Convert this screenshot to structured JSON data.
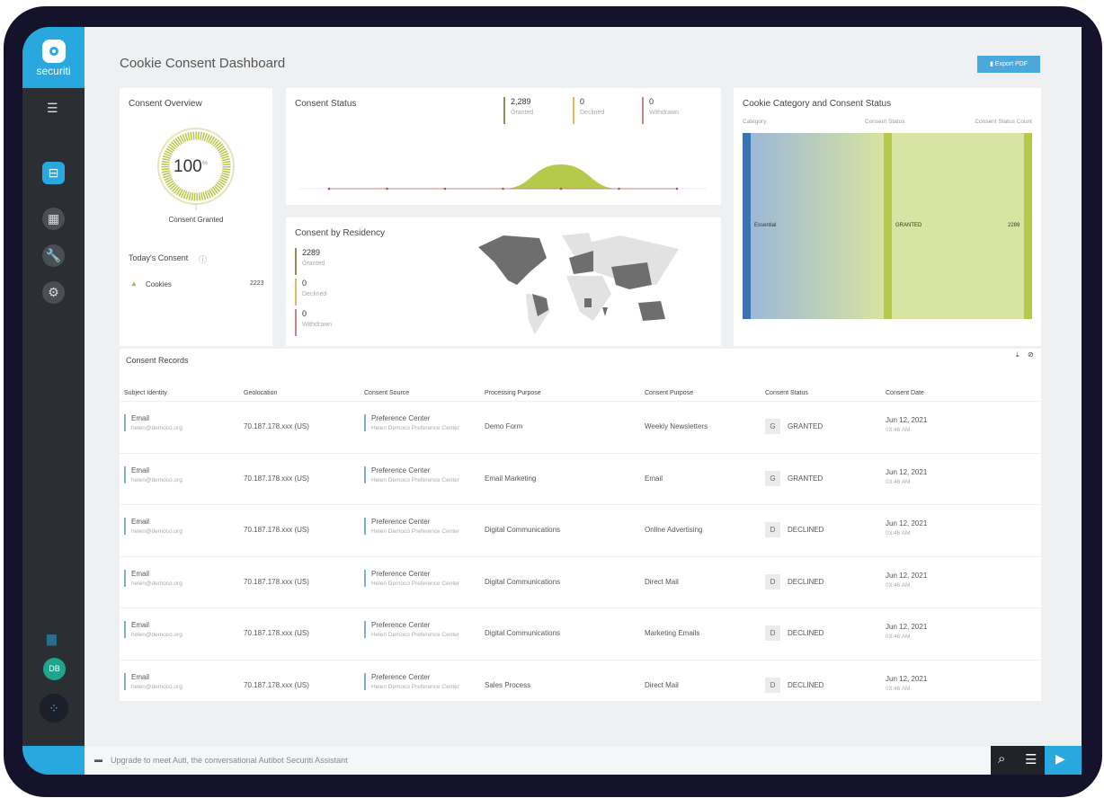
{
  "app": {
    "brand": "securiti",
    "page_title": "Cookie Consent Dashboard",
    "export_label": "Export PDF",
    "user_initials": "DB"
  },
  "colors": {
    "brand": "#29a8e0",
    "granted": "#b5c94a",
    "declined": "#e1b86a",
    "withdrawn": "#c98585",
    "essential": "#3a73b0"
  },
  "overview": {
    "title": "Consent Overview",
    "percent": "100",
    "percent_unit": "%",
    "gauge_label": "Consent Granted",
    "gauge_fraction": 1.0,
    "today_title": "Today's Consent",
    "items": [
      {
        "label": "Cookies",
        "value": "2223"
      }
    ]
  },
  "status": {
    "title": "Consent Status",
    "stats": [
      {
        "value": "2,289",
        "label": "Granted"
      },
      {
        "value": "0",
        "label": "Declined"
      },
      {
        "value": "0",
        "label": "Withdrawn"
      }
    ]
  },
  "residency": {
    "title": "Consent by Residency",
    "stats": [
      {
        "value": "2289",
        "label": "Granted"
      },
      {
        "value": "0",
        "label": "Declined"
      },
      {
        "value": "0",
        "label": "Withdrawn"
      }
    ]
  },
  "chart_data": [
    {
      "type": "area",
      "title": "Consent Status",
      "x": [
        1,
        2,
        3,
        4,
        5,
        6,
        7
      ],
      "series": [
        {
          "name": "Granted",
          "values": [
            0,
            0,
            0,
            0,
            2289,
            0,
            0
          ]
        },
        {
          "name": "Withdrawn",
          "values": [
            0,
            0,
            0,
            0,
            0,
            0,
            0
          ]
        }
      ],
      "grid": false
    },
    {
      "type": "sankey",
      "title": "Cookie Category and Consent Status",
      "columns": [
        "Category",
        "Consent Status",
        "Consent Status Count"
      ],
      "flows": [
        {
          "source": "Essential",
          "target": "GRANTED",
          "value": 2289
        }
      ],
      "count_label": "2289"
    }
  ],
  "records": {
    "title": "Consent Records",
    "columns": [
      "Subject Identity",
      "Geolocation",
      "Consent Source",
      "Processing Purpose",
      "Consent Purpose",
      "Consent Status",
      "Consent Date"
    ],
    "rows": [
      {
        "id": "Email",
        "email": "helen@democo.org",
        "geo": "70.187.178.xxx (US)",
        "source": "Preference Center",
        "source_sub": "Helen Democo Preference Center",
        "processing": "Demo Form",
        "purpose": "Weekly Newsletters",
        "badge": "G",
        "status": "GRANTED",
        "date": "Jun 12, 2021",
        "time": "03:46 AM"
      },
      {
        "id": "Email",
        "email": "helen@democo.org",
        "geo": "70.187.178.xxx (US)",
        "source": "Preference Center",
        "source_sub": "Helen Democo Preference Center",
        "processing": "Email Marketing",
        "purpose": "Email",
        "badge": "G",
        "status": "GRANTED",
        "date": "Jun 12, 2021",
        "time": "03:46 AM"
      },
      {
        "id": "Email",
        "email": "helen@democo.org",
        "geo": "70.187.178.xxx (US)",
        "source": "Preference Center",
        "source_sub": "Helen Democo Preference Center",
        "processing": "Digital Communications",
        "purpose": "Online Advertising",
        "badge": "D",
        "status": "DECLINED",
        "date": "Jun 12, 2021",
        "time": "03:46 AM"
      },
      {
        "id": "Email",
        "email": "helen@democo.org",
        "geo": "70.187.178.xxx (US)",
        "source": "Preference Center",
        "source_sub": "Helen Democo Preference Center",
        "processing": "Digital Communications",
        "purpose": "Direct Mail",
        "badge": "D",
        "status": "DECLINED",
        "date": "Jun 12, 2021",
        "time": "03:46 AM"
      },
      {
        "id": "Email",
        "email": "helen@democo.org",
        "geo": "70.187.178.xxx (US)",
        "source": "Preference Center",
        "source_sub": "Helen Democo Preference Center",
        "processing": "Digital Communications",
        "purpose": "Marketing Emails",
        "badge": "D",
        "status": "DECLINED",
        "date": "Jun 12, 2021",
        "time": "03:46 AM"
      },
      {
        "id": "Email",
        "email": "helen@democo.org",
        "geo": "70.187.178.xxx (US)",
        "source": "Preference Center",
        "source_sub": "Helen Democo Preference Center",
        "processing": "Sales Process",
        "purpose": "Direct Mail",
        "badge": "D",
        "status": "DECLINED",
        "date": "Jun 12, 2021",
        "time": "03:46 AM"
      }
    ]
  },
  "assistant": {
    "placeholder": "Upgrade to meet Auti, the conversational Autibot Securiti Assistant"
  }
}
